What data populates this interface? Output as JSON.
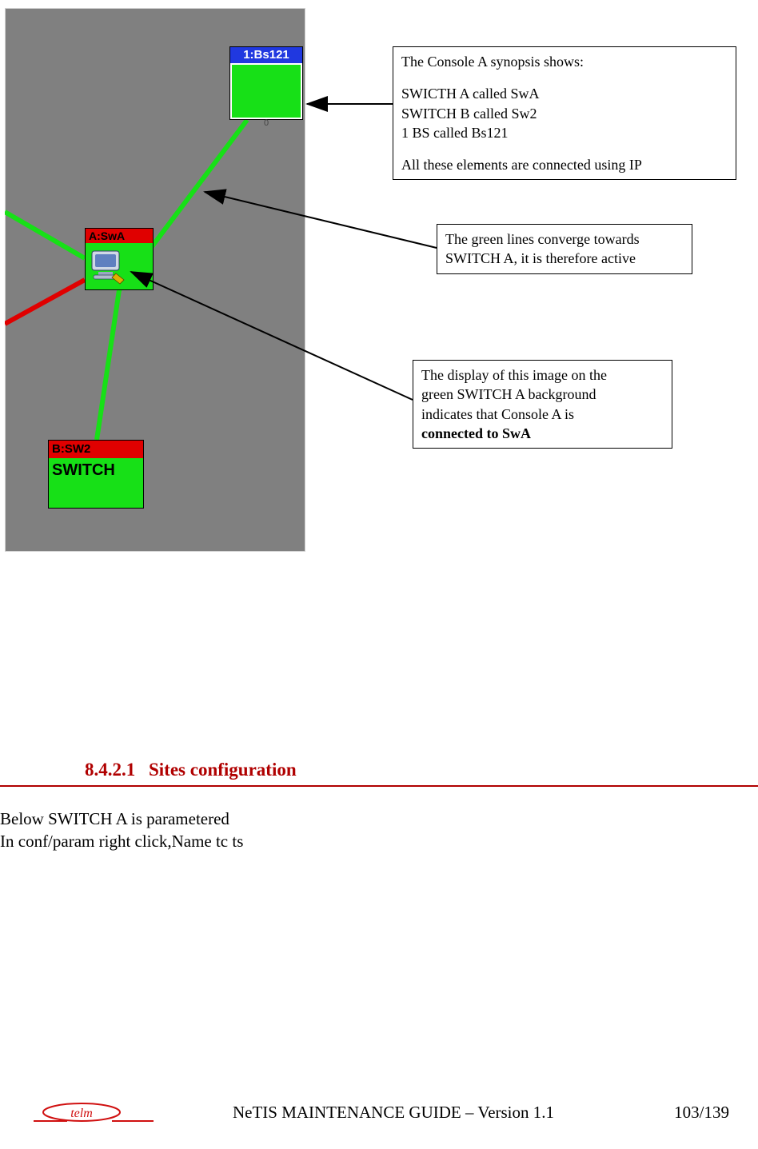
{
  "figure": {
    "nodes": {
      "bs": {
        "title": "1:Bs121",
        "footer_text": "0"
      },
      "swa": {
        "title": "A:SwA"
      },
      "sw2": {
        "title": "B:SW2",
        "body_label": "SWITCH"
      }
    },
    "callouts": {
      "c1_line1": "The Console A synopsis shows:",
      "c1_line2": "SWICTH A called SwA",
      "c1_line3": "SWITCH B called Sw2",
      "c1_line4": "1 BS called Bs121",
      "c1_line5": "All these elements are connected using IP",
      "c2_line1": "The green lines converge towards",
      "c2_line2": "SWITCH A, it is therefore active",
      "c3_line1": "The display of this image on the",
      "c3_line2": "green SWITCH A background",
      "c3_line3": "indicates that Console A is",
      "c3_line4": "connected to SwA"
    }
  },
  "section": {
    "number": "8.4.2.1",
    "title": "Sites configuration"
  },
  "body": {
    "line1": "Below SWITCH A is parametered",
    "line2": "In conf/param right click,Name tc ts"
  },
  "footer": {
    "doc_title": "NeTIS MAINTENANCE GUIDE – Version 1.1",
    "pagenum": "103/139",
    "logo_text": "telm"
  }
}
